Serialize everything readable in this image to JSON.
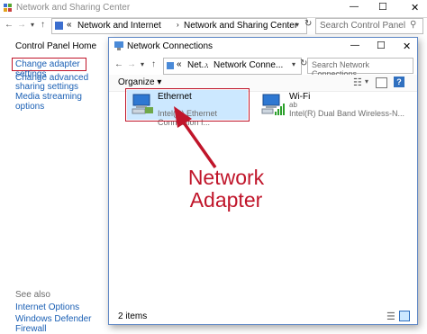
{
  "window": {
    "title": "Network and Sharing Center",
    "min_label": "—",
    "max_label": "☐",
    "close_label": "✕",
    "address": {
      "prefix": "«",
      "path": [
        "Network and Internet",
        "Network and Sharing Center"
      ]
    },
    "search_placeholder": "Search Control Panel"
  },
  "sidebar": {
    "home": "Control Panel Home",
    "links": [
      "Change adapter settings",
      "Change advanced sharing settings",
      "Media streaming options"
    ],
    "see_also_label": "See also",
    "see_also": [
      "Internet Options",
      "Windows Defender Firewall"
    ]
  },
  "dialog": {
    "title": "Network Connections",
    "min_label": "—",
    "max_label": "☐",
    "close_label": "✕",
    "address": {
      "prefix": "«",
      "path": [
        "Net...",
        "Network Conne..."
      ]
    },
    "search_placeholder": "Search Network Connections",
    "organize_label": "Organize ▾",
    "help_label": "?",
    "adapters": [
      {
        "name": "Ethernet",
        "status": "",
        "description": "Intel(R) Ethernet Connection I..."
      },
      {
        "name": "Wi-Fi",
        "status": "ab",
        "description": "Intel(R) Dual Band Wireless-N..."
      }
    ],
    "item_count": "2 items"
  },
  "annotation": {
    "line1": "Network",
    "line2": "Adapter",
    "color": "#c0152a"
  },
  "colors": {
    "link": "#1a5fb4",
    "highlight_red": "#c0152a",
    "dialog_border": "#5e87c5",
    "selection_blue": "#cce8ff"
  }
}
